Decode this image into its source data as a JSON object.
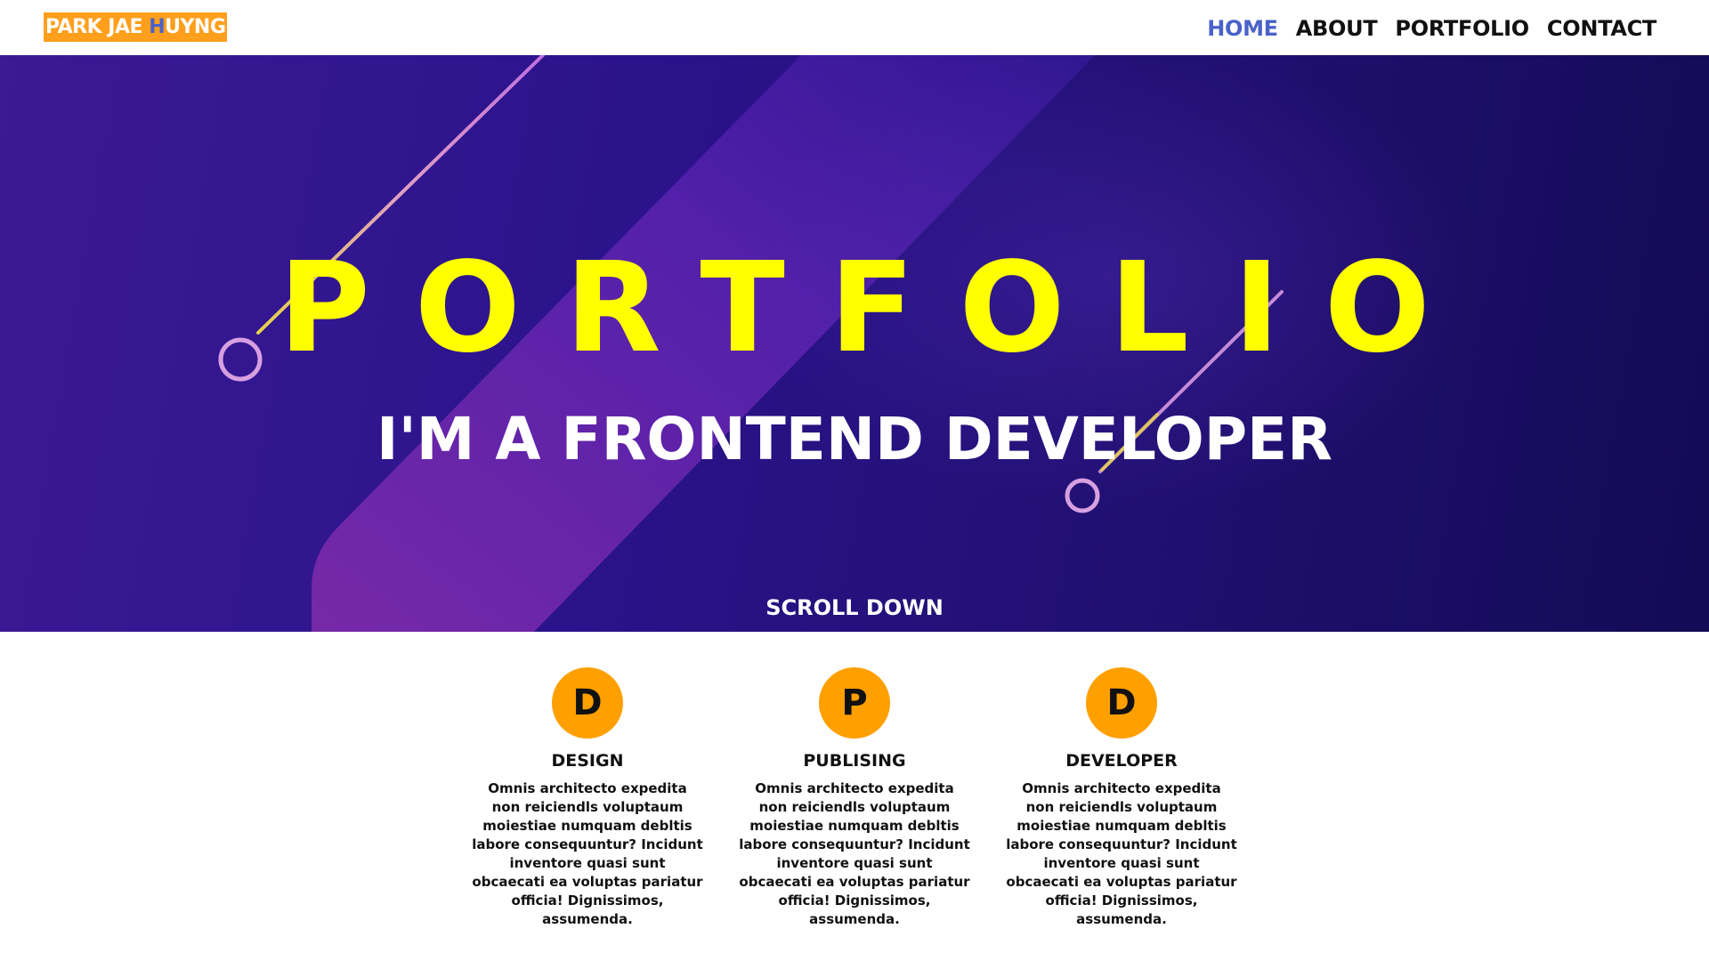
{
  "header": {
    "logo_part1": "PARK JAE ",
    "logo_highlight": "H",
    "logo_part2": "UYNG",
    "nav": [
      {
        "label": "HOME"
      },
      {
        "label": "ABOUT"
      },
      {
        "label": "PORTFOLIO"
      },
      {
        "label": "CONTACT"
      }
    ]
  },
  "hero": {
    "title": "PORTFOLIO",
    "subtitle": "I'M A FRONTEND DEVELOPER",
    "scroll_label": "SCROLL DOWN"
  },
  "services": [
    {
      "letter": "D",
      "title": "DESIGN",
      "desc": "Omnis architecto expedita non reiciendls voluptaum moiestiae numquam debltis labore consequuntur? Incidunt inventore quasi sunt obcaecati ea voluptas pariatur officia! Dignissimos, assumenda."
    },
    {
      "letter": "P",
      "title": "PUBLISING",
      "desc": "Omnis architecto expedita non reiciendls voluptaum moiestiae numquam debltis labore consequuntur? Incidunt inventore quasi sunt obcaecati ea voluptas pariatur officia! Dignissimos, assumenda."
    },
    {
      "letter": "D",
      "title": "DEVELOPER",
      "desc": "Omnis architecto expedita non reiciendls voluptaum moiestiae numquam debltis labore consequuntur? Incidunt inventore quasi sunt obcaecati ea voluptas pariatur officia! Dignissimos, assumenda."
    }
  ],
  "colors": {
    "logo_bg": "#ff9f1c",
    "accent_blue": "#4a62c8",
    "hero_title": "#ffff00",
    "service_icon": "#ff9f00"
  }
}
